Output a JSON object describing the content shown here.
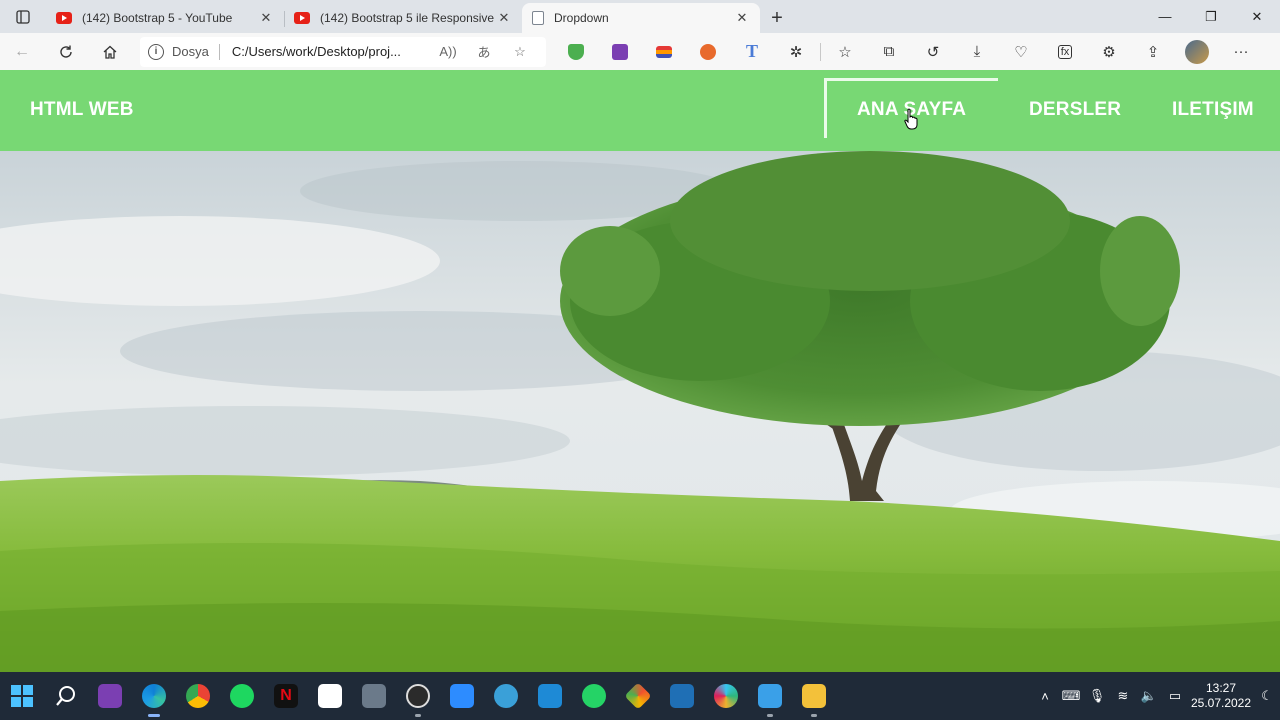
{
  "browser": {
    "tabs": [
      {
        "title": "(142) Bootstrap 5 - YouTube",
        "favicon": "youtube-icon",
        "active": false
      },
      {
        "title": "(142) Bootstrap 5 ile Responsive",
        "favicon": "youtube-icon",
        "active": false
      },
      {
        "title": "Dropdown",
        "favicon": "document-icon",
        "active": true
      }
    ],
    "address": {
      "protocol_label": "Dosya",
      "url": "C:/Users/work/Desktop/proj..."
    }
  },
  "page": {
    "brand": "HTML WEB",
    "nav": {
      "home": "ANA SAYFA",
      "courses": "DERSLER",
      "contact": "ILETIŞIM"
    },
    "colors": {
      "navbar": "#78d874",
      "nav_text": "#ffffff"
    }
  },
  "taskbar": {
    "apps": [
      "start-icon",
      "search-icon",
      "onenote-icon",
      "edge-icon",
      "chrome-icon",
      "spotify-icon",
      "netflix-icon",
      "graph-icon",
      "calculator-icon",
      "obs-icon",
      "zoom-icon",
      "globe-icon",
      "vscode-icon",
      "whatsapp-icon",
      "git-icon",
      "photos-icon",
      "slack-icon",
      "notepad-icon",
      "file-explorer-icon"
    ],
    "time": "13:27",
    "date": "25.07.2022"
  }
}
